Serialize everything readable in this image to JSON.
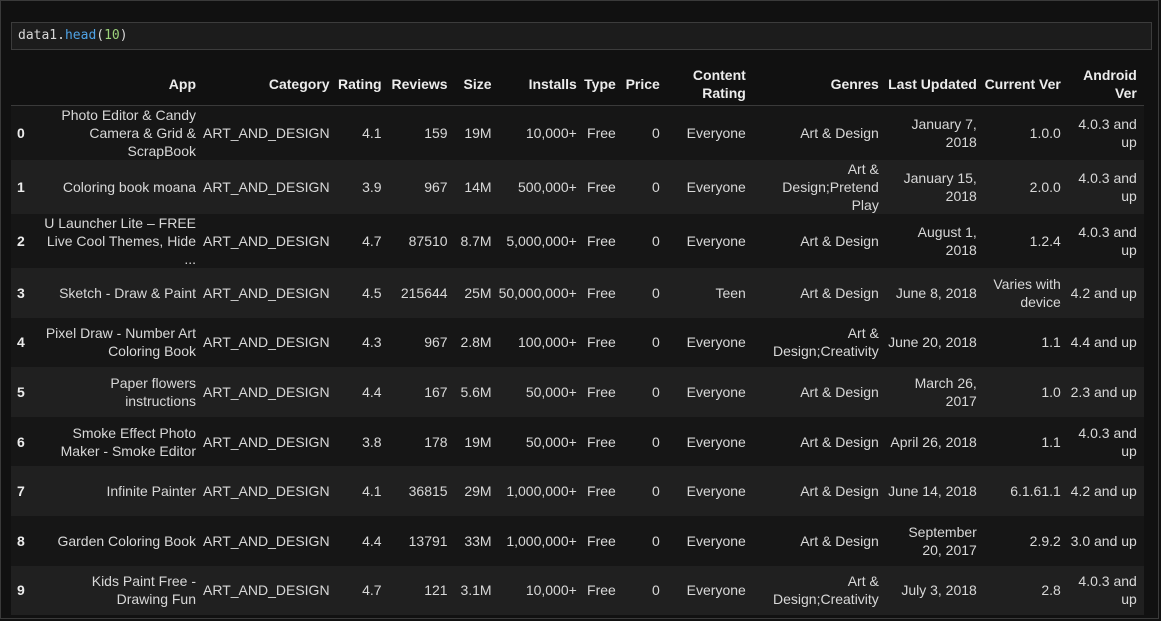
{
  "cell": {
    "code_var": "data1",
    "code_dot": ".",
    "code_fn": "head",
    "code_open": "(",
    "code_arg": "10",
    "code_close": ")"
  },
  "table": {
    "columns": [
      "App",
      "Category",
      "Rating",
      "Reviews",
      "Size",
      "Installs",
      "Type",
      "Price",
      "Content Rating",
      "Genres",
      "Last Updated",
      "Current Ver",
      "Android Ver"
    ],
    "rows": [
      {
        "index": "0",
        "cells": [
          "Photo Editor & Candy Camera & Grid & ScrapBook",
          "ART_AND_DESIGN",
          "4.1",
          "159",
          "19M",
          "10,000+",
          "Free",
          "0",
          "Everyone",
          "Art & Design",
          "January 7, 2018",
          "1.0.0",
          "4.0.3 and up"
        ]
      },
      {
        "index": "1",
        "cells": [
          "Coloring book moana",
          "ART_AND_DESIGN",
          "3.9",
          "967",
          "14M",
          "500,000+",
          "Free",
          "0",
          "Everyone",
          "Art & Design;Pretend Play",
          "January 15, 2018",
          "2.0.0",
          "4.0.3 and up"
        ]
      },
      {
        "index": "2",
        "cells": [
          "U Launcher Lite – FREE Live Cool Themes, Hide ...",
          "ART_AND_DESIGN",
          "4.7",
          "87510",
          "8.7M",
          "5,000,000+",
          "Free",
          "0",
          "Everyone",
          "Art & Design",
          "August 1, 2018",
          "1.2.4",
          "4.0.3 and up"
        ]
      },
      {
        "index": "3",
        "cells": [
          "Sketch - Draw & Paint",
          "ART_AND_DESIGN",
          "4.5",
          "215644",
          "25M",
          "50,000,000+",
          "Free",
          "0",
          "Teen",
          "Art & Design",
          "June 8, 2018",
          "Varies with device",
          "4.2 and up"
        ]
      },
      {
        "index": "4",
        "cells": [
          "Pixel Draw - Number Art Coloring Book",
          "ART_AND_DESIGN",
          "4.3",
          "967",
          "2.8M",
          "100,000+",
          "Free",
          "0",
          "Everyone",
          "Art & Design;Creativity",
          "June 20, 2018",
          "1.1",
          "4.4 and up"
        ]
      },
      {
        "index": "5",
        "cells": [
          "Paper flowers instructions",
          "ART_AND_DESIGN",
          "4.4",
          "167",
          "5.6M",
          "50,000+",
          "Free",
          "0",
          "Everyone",
          "Art & Design",
          "March 26, 2017",
          "1.0",
          "2.3 and up"
        ]
      },
      {
        "index": "6",
        "cells": [
          "Smoke Effect Photo Maker - Smoke Editor",
          "ART_AND_DESIGN",
          "3.8",
          "178",
          "19M",
          "50,000+",
          "Free",
          "0",
          "Everyone",
          "Art & Design",
          "April 26, 2018",
          "1.1",
          "4.0.3 and up"
        ]
      },
      {
        "index": "7",
        "cells": [
          "Infinite Painter",
          "ART_AND_DESIGN",
          "4.1",
          "36815",
          "29M",
          "1,000,000+",
          "Free",
          "0",
          "Everyone",
          "Art & Design",
          "June 14, 2018",
          "6.1.61.1",
          "4.2 and up"
        ]
      },
      {
        "index": "8",
        "cells": [
          "Garden Coloring Book",
          "ART_AND_DESIGN",
          "4.4",
          "13791",
          "33M",
          "1,000,000+",
          "Free",
          "0",
          "Everyone",
          "Art & Design",
          "September 20, 2017",
          "2.9.2",
          "3.0 and up"
        ]
      },
      {
        "index": "9",
        "cells": [
          "Kids Paint Free - Drawing Fun",
          "ART_AND_DESIGN",
          "4.7",
          "121",
          "3.1M",
          "10,000+",
          "Free",
          "0",
          "Everyone",
          "Art & Design;Creativity",
          "July 3, 2018",
          "2.8",
          "4.0.3 and up"
        ]
      }
    ]
  }
}
